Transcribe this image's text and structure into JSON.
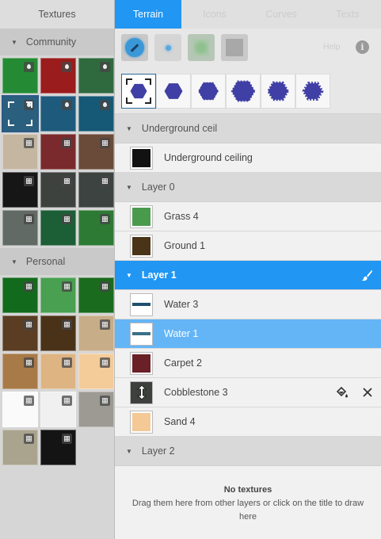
{
  "textures_panel": {
    "title": "Textures",
    "groups": [
      {
        "label": "Community",
        "tiles": [
          {
            "color": "#248b34",
            "badge": "drop"
          },
          {
            "color": "#9a1c1c",
            "badge": "drop"
          },
          {
            "color": "#2f6a3f",
            "badge": "drop"
          },
          {
            "color": "#2b5f7e",
            "badge": "drop",
            "selected": true
          },
          {
            "color": "#1e5a7c",
            "badge": "drop"
          },
          {
            "color": "#165976",
            "badge": "drop"
          },
          {
            "color": "#c5b6a2",
            "badge": "pattern"
          },
          {
            "color": "#7a2a2c",
            "badge": "pattern"
          },
          {
            "color": "#6a4a38",
            "badge": "pattern"
          },
          {
            "color": "#161616",
            "badge": "pattern"
          },
          {
            "color": "#3e423f",
            "badge": "pattern"
          },
          {
            "color": "#3c4340",
            "badge": "pattern"
          },
          {
            "color": "#626a66",
            "badge": "pattern"
          },
          {
            "color": "#1c5e36",
            "badge": "pattern"
          },
          {
            "color": "#2d7a34",
            "badge": "pattern"
          }
        ]
      },
      {
        "label": "Personal",
        "tiles": [
          {
            "color": "#126b1c",
            "badge": "pattern"
          },
          {
            "color": "#48a050",
            "badge": "pattern"
          },
          {
            "color": "#1a6b1e",
            "badge": "pattern"
          },
          {
            "color": "#5a3d22",
            "badge": "pattern"
          },
          {
            "color": "#4a3218",
            "badge": "pattern"
          },
          {
            "color": "#c7ad88",
            "badge": "pattern"
          },
          {
            "color": "#a87a48",
            "badge": "pattern"
          },
          {
            "color": "#deb483",
            "badge": "pattern"
          },
          {
            "color": "#f4cc9a",
            "badge": "pattern"
          },
          {
            "color": "#fafafa",
            "badge": "pattern"
          },
          {
            "color": "#f0f0f0",
            "badge": "pattern"
          },
          {
            "color": "#9c9a92",
            "badge": "pattern"
          },
          {
            "color": "#aaa48e",
            "badge": "pattern"
          },
          {
            "color": "#141414",
            "badge": "pattern"
          }
        ]
      }
    ]
  },
  "tabs": [
    {
      "label": "Terrain",
      "active": true
    },
    {
      "label": "Icons",
      "active": false
    },
    {
      "label": "Curves",
      "active": false
    },
    {
      "label": "Texts",
      "active": false
    }
  ],
  "toolbar": {
    "tools": [
      "paint-brush-tool",
      "point-tool",
      "soft-brush-tool",
      "square-tool"
    ],
    "help_label": "Help",
    "info_glyph": "i"
  },
  "brush_sizes": [
    {
      "size": 1,
      "selected": true
    },
    {
      "size": 2
    },
    {
      "size": 3
    },
    {
      "size": 4
    },
    {
      "size": 5
    },
    {
      "size": 6
    }
  ],
  "brush_color": "#3f3fa5",
  "layers": [
    {
      "label": "Underground ceil",
      "active": false,
      "items": [
        {
          "name": "Underground ceiling",
          "swatch": "#121212",
          "kind": "fill"
        }
      ]
    },
    {
      "label": "Layer 0",
      "active": false,
      "items": [
        {
          "name": "Grass 4",
          "swatch": "#4a9a4e",
          "kind": "fill"
        },
        {
          "name": "Ground 1",
          "swatch": "#4a3418",
          "kind": "fill"
        }
      ]
    },
    {
      "label": "Layer 1",
      "active": true,
      "items": [
        {
          "name": "Water 3",
          "swatch": "#1f4f6e",
          "kind": "line"
        },
        {
          "name": "Water 1",
          "swatch": "#3a6f88",
          "kind": "line",
          "hover": true
        },
        {
          "name": "Carpet 2",
          "swatch": "#6a2026",
          "kind": "fill"
        },
        {
          "name": "Cobblestone 3",
          "swatch": "#3d403d",
          "kind": "fill",
          "dragging": true
        },
        {
          "name": "Sand 4",
          "swatch": "#f4c996",
          "kind": "fill"
        }
      ]
    },
    {
      "label": "Layer 2",
      "active": false,
      "items": []
    }
  ],
  "empty_state": {
    "title": "No textures",
    "line1": "Drag them here from other layers or click on the title to draw",
    "line2": "here"
  }
}
